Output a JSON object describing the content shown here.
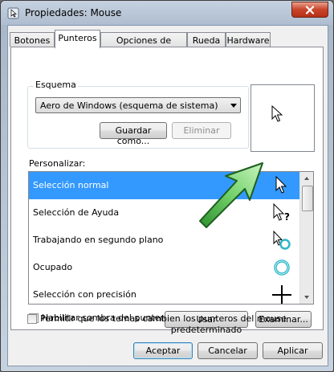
{
  "window": {
    "title": "Propiedades: Mouse"
  },
  "tabs": [
    {
      "label": "Botones"
    },
    {
      "label": "Punteros"
    },
    {
      "label": "Opciones de puntero"
    },
    {
      "label": "Rueda"
    },
    {
      "label": "Hardware"
    }
  ],
  "active_tab": "Punteros",
  "scheme": {
    "label": "Esquema",
    "selected": "Aero de Windows (esquema de sistema)",
    "save_as": "Guardar como...",
    "delete": "Eliminar"
  },
  "customize": {
    "label": "Personalizar:",
    "items": [
      {
        "label": "Selección normal",
        "icon": "arrow-cursor-icon",
        "selected": true
      },
      {
        "label": "Selección de Ayuda",
        "icon": "help-cursor-icon"
      },
      {
        "label": "Trabajando en segundo plano",
        "icon": "working-cursor-icon"
      },
      {
        "label": "Ocupado",
        "icon": "busy-cursor-icon"
      },
      {
        "label": "Selección con precisión",
        "icon": "crosshair-cursor-icon"
      }
    ]
  },
  "shadow_checkbox": {
    "label": "Habilitar sombra del puntero",
    "checked": false
  },
  "use_default": "Usar predeterminado",
  "browse": "Examinar...",
  "themes_checkbox": {
    "label": "Permitir que los temas cambien los punteros del mouse",
    "checked": false
  },
  "footer": {
    "accept": "Aceptar",
    "cancel": "Cancelar",
    "apply": "Aplicar"
  },
  "colors": {
    "selection": "#3399ff",
    "arrow_overlay": "#3fae3f"
  }
}
